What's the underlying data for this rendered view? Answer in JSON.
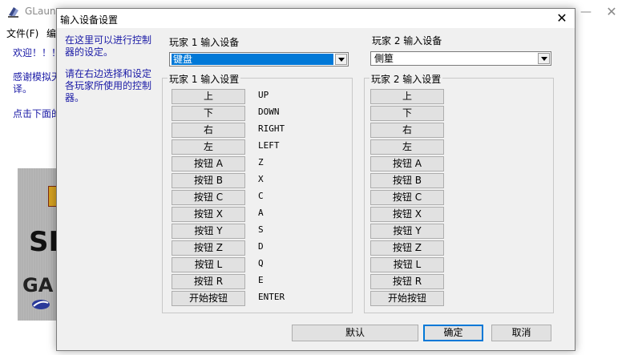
{
  "main_window": {
    "title": "GLaunc",
    "min_glyph": "—",
    "close_glyph": "✕",
    "menu": [
      "文件(F)",
      "编"
    ],
    "welcome_lines": [
      "欢迎！！！",
      "感谢模拟天",
      "译。",
      "点击下面的"
    ],
    "logo_letters": [
      "SE",
      "GA"
    ]
  },
  "dialog": {
    "title": "输入设备设置",
    "close_glyph": "✕",
    "hint_top": "在这里可以进行控制器的设定。",
    "hint_bottom": "请在右边选择和设定各玩家所使用的控制器。",
    "player1": {
      "device_label": "玩家 1 输入设备",
      "device_value": "键盘",
      "settings_label": "玩家 1 输入设置",
      "keys": [
        {
          "button": "上",
          "value": "UP"
        },
        {
          "button": "下",
          "value": "DOWN"
        },
        {
          "button": "右",
          "value": "RIGHT"
        },
        {
          "button": "左",
          "value": "LEFT"
        },
        {
          "button": "按钮 A",
          "value": "Z"
        },
        {
          "button": "按钮 B",
          "value": "X"
        },
        {
          "button": "按钮 C",
          "value": "C"
        },
        {
          "button": "按钮 X",
          "value": "A"
        },
        {
          "button": "按钮 Y",
          "value": "S"
        },
        {
          "button": "按钮 Z",
          "value": "D"
        },
        {
          "button": "按钮 L",
          "value": "Q"
        },
        {
          "button": "按钮 R",
          "value": "E"
        },
        {
          "button": "开始按钮",
          "value": "ENTER"
        }
      ]
    },
    "player2": {
      "device_label": "玩家 2 输入设备",
      "device_value": "側篂",
      "settings_label": "玩家 2 输入设置",
      "keys": [
        "上",
        "下",
        "右",
        "左",
        "按钮 A",
        "按钮 B",
        "按钮 C",
        "按钮 X",
        "按钮 Y",
        "按钮 Z",
        "按钮 L",
        "按钮 R",
        "开始按钮"
      ]
    },
    "buttons": {
      "default": "默认",
      "ok": "确定",
      "cancel": "取消"
    }
  },
  "colors": {
    "hint_text": "#1a1aa6",
    "selection": "#0078d7",
    "dialog_bg": "#f0f0f0"
  }
}
